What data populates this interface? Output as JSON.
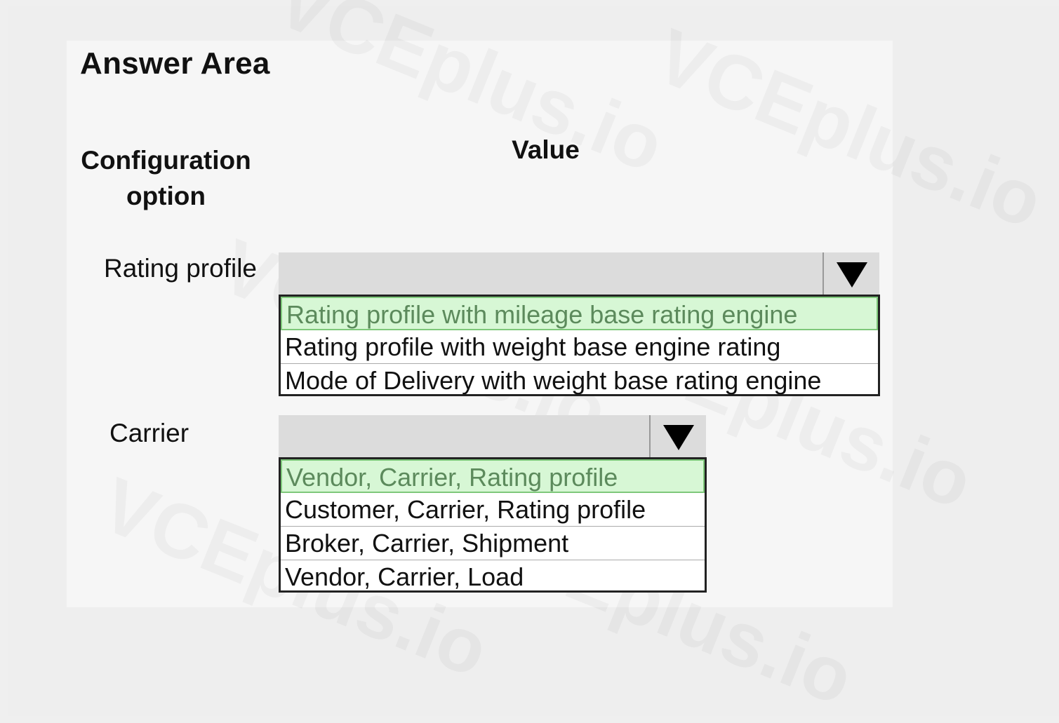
{
  "answer_area": {
    "title": "Answer Area",
    "headers": {
      "config_line1": "Configuration",
      "config_line2": "option",
      "value": "Value"
    }
  },
  "rows": [
    {
      "label": "Rating profile",
      "options": [
        "Rating profile with mileage base rating engine",
        "Rating profile with weight base engine rating",
        "Mode of Delivery with weight base rating engine"
      ],
      "selected_index": 0
    },
    {
      "label": "Carrier",
      "options": [
        "Vendor, Carrier, Rating profile",
        "Customer, Carrier, Rating profile",
        "Broker, Carrier, Shipment",
        "Vendor, Carrier, Load"
      ],
      "selected_index": 0
    }
  ],
  "icons": {
    "dropdown_arrow": "triangle-down-icon"
  },
  "colors": {
    "selected_option_bg": "#d7f7d5",
    "selected_option_text": "#5c8a5c",
    "dropdown_header_bg": "#dcdcdc"
  },
  "watermark": "VCEplus.io"
}
